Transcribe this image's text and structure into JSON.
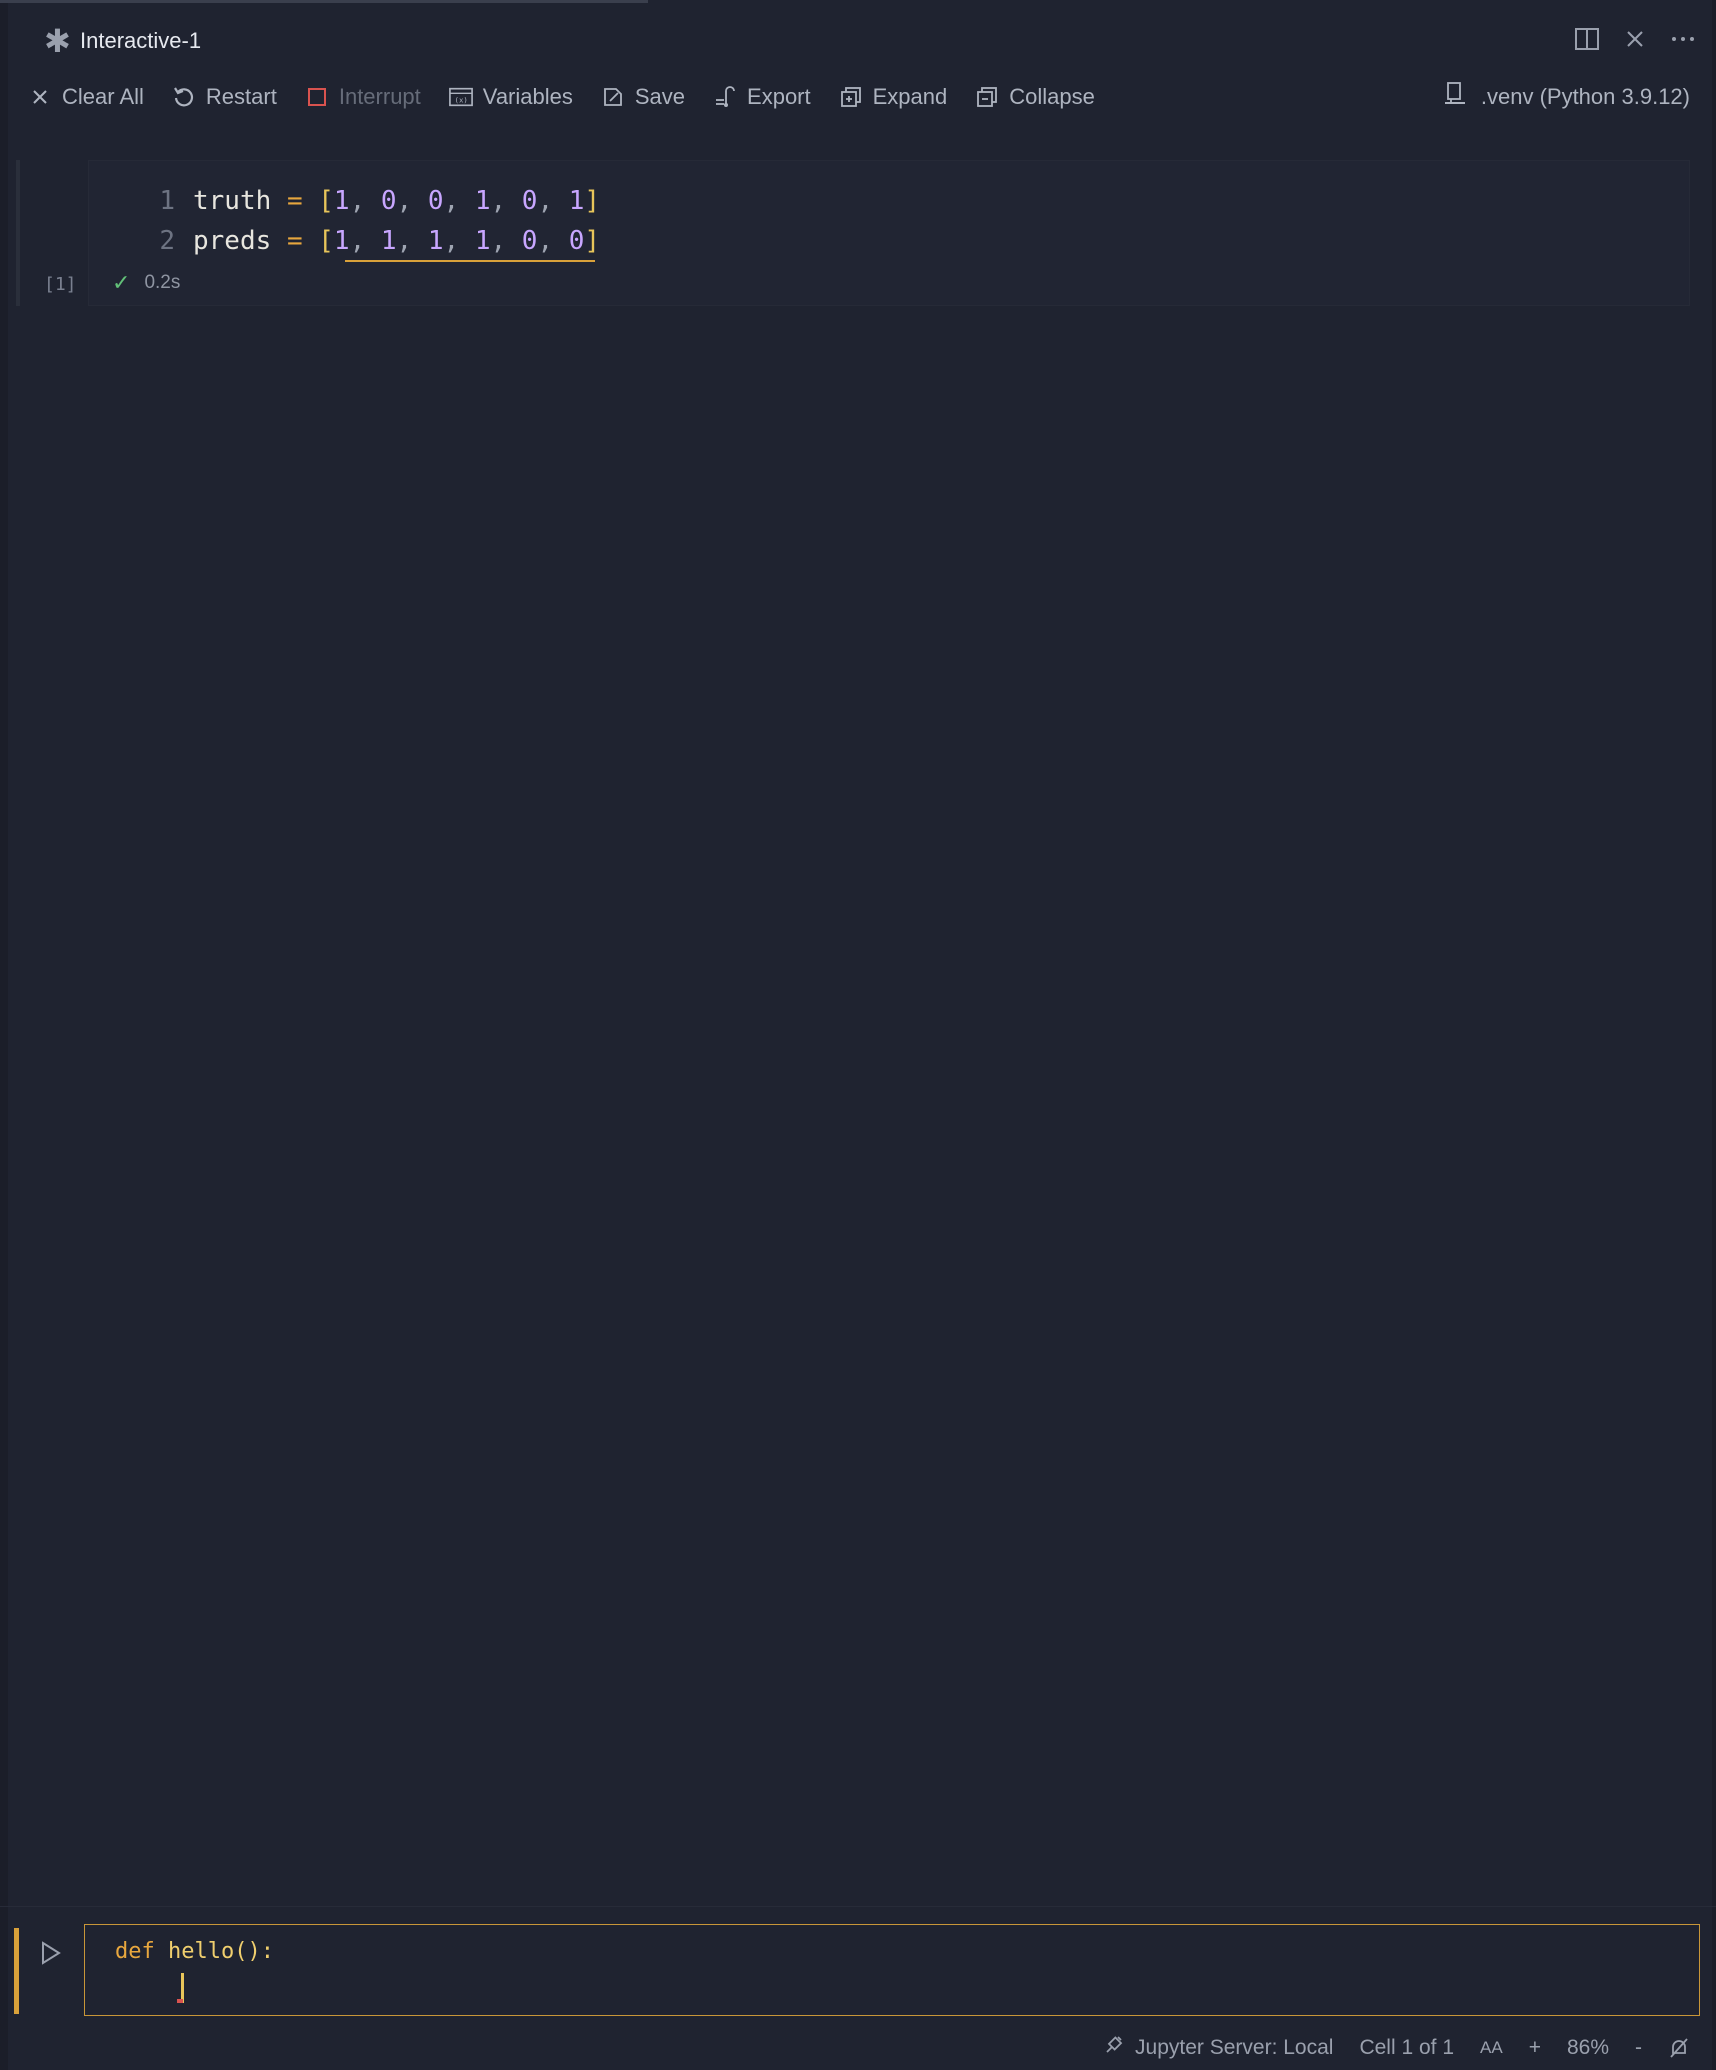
{
  "tab": {
    "title": "Interactive-1",
    "icon": "asterisk-icon"
  },
  "toolbar": {
    "clear_all": "Clear All",
    "restart": "Restart",
    "interrupt": "Interrupt",
    "variables": "Variables",
    "save": "Save",
    "export": "Export",
    "expand": "Expand",
    "collapse": "Collapse"
  },
  "kernel": {
    "label": ".venv (Python 3.9.12)"
  },
  "cell": {
    "execution_count": "[1]",
    "duration": "0.2s",
    "lines": [
      {
        "number": "1",
        "name": "truth",
        "op": "=",
        "open": "[",
        "close": "]",
        "values": [
          "1",
          "0",
          "0",
          "1",
          "0",
          "1"
        ]
      },
      {
        "number": "2",
        "name": "preds",
        "op": "=",
        "open": "[",
        "close": "]",
        "values": [
          "1",
          "1",
          "1",
          "1",
          "0",
          "0"
        ]
      }
    ]
  },
  "input": {
    "keyword": "def",
    "function": "hello():"
  },
  "status": {
    "server": "Jupyter Server: Local",
    "cell_position": "Cell 1 of 1",
    "font_size_icon": "AA",
    "zoom_in": "+",
    "zoom": "86%",
    "zoom_out": "-"
  },
  "colors": {
    "background": "#1f2330",
    "accent": "#d9a13a",
    "success": "#62c078",
    "number": "#c8a6ff"
  }
}
